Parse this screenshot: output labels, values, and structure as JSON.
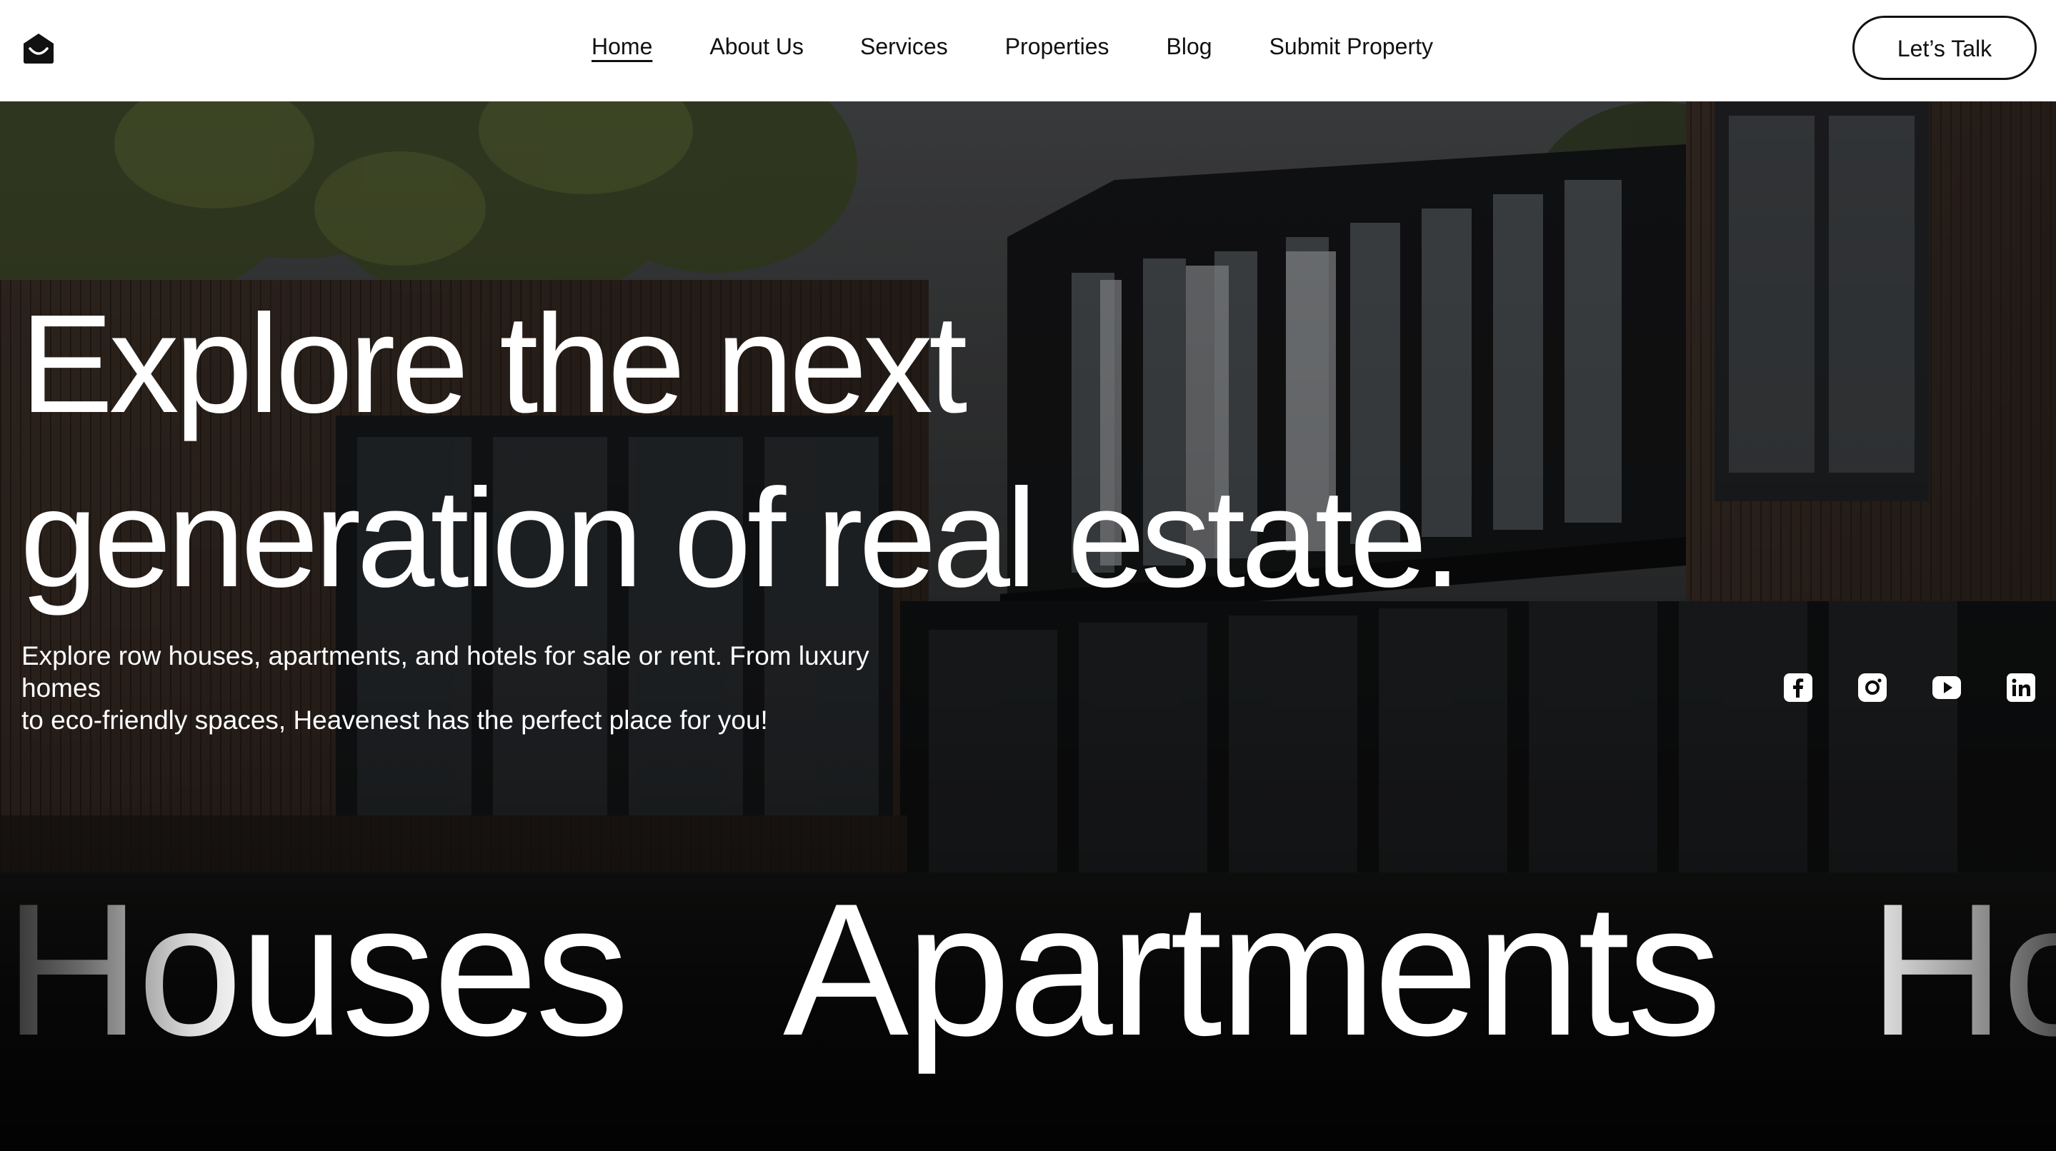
{
  "brand": {
    "logo_icon": "house-smile-icon"
  },
  "nav": {
    "items": [
      {
        "label": "Home",
        "active": true
      },
      {
        "label": "About Us",
        "active": false
      },
      {
        "label": "Services",
        "active": false
      },
      {
        "label": "Properties",
        "active": false
      },
      {
        "label": "Blog",
        "active": false
      },
      {
        "label": "Submit Property",
        "active": false
      }
    ],
    "cta_label": "Let’s Talk"
  },
  "hero": {
    "headline_line1": "Explore the next",
    "headline_line2": "generation of real estate.",
    "subtext_line1": "Explore row houses, apartments, and hotels for sale or rent. From luxury homes",
    "subtext_line2": "to eco-friendly spaces, Heavenest has the perfect place for you!"
  },
  "social": [
    {
      "icon": "facebook-icon"
    },
    {
      "icon": "instagram-icon"
    },
    {
      "icon": "youtube-icon"
    },
    {
      "icon": "linkedin-icon"
    }
  ],
  "marquee": {
    "words": [
      "Houses",
      "Apartments",
      "Ho"
    ]
  },
  "colors": {
    "nav_background": "#ffffff",
    "text_dark": "#111111",
    "hero_text": "#ffffff",
    "page_background": "#0a0a0a"
  }
}
